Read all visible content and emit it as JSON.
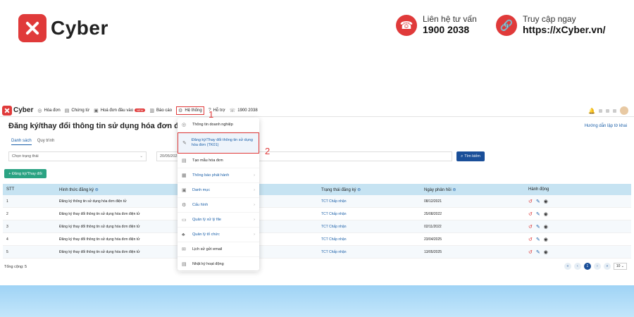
{
  "banner": {
    "logo_text": "Cyber",
    "contact1": {
      "line1": "Liên hệ tư vấn",
      "line2": "1900 2038",
      "icon": "phone-icon"
    },
    "contact2": {
      "line1": "Truy cập ngay",
      "line2": "https://xCyber.vn/",
      "icon": "link-icon"
    }
  },
  "navbar": {
    "logo": "Cyber",
    "items": [
      {
        "label": "Hóa đơn",
        "icon": "invoice-icon"
      },
      {
        "label": "Chứng từ",
        "icon": "document-icon"
      },
      {
        "label": "Hoá đơn đầu vào",
        "icon": "inbox-icon",
        "badge": "NEW"
      },
      {
        "label": "Báo cáo",
        "icon": "report-icon"
      },
      {
        "label": "Hệ thống",
        "icon": "settings-icon"
      },
      {
        "label": "Hỗ trợ",
        "icon": "help-icon"
      },
      {
        "label": "1900 2038",
        "icon": "phone-icon"
      }
    ]
  },
  "page": {
    "title": "Đăng ký/thay đổi thông tin sử dụng hóa đơn điện tử",
    "help_link": "Hướng dẫn lập tờ khai",
    "tabs": [
      "Danh sách",
      "Quy trình"
    ],
    "filter_placeholder": "Chọn trạng thái",
    "date_value": "20/05/2025",
    "search_label": "Tìm kiếm",
    "add_label": "+ Đăng ký/Thay đổi",
    "total_label": "Tổng cộng: 5"
  },
  "table": {
    "headers": [
      "STT",
      "Hình thức đăng ký",
      "Trạng thái đăng ký",
      "Ngày phản hồi",
      "Hành động"
    ],
    "rows": [
      {
        "stt": "1",
        "form": "Đăng ký thông tin sử dụng hóa đơn điện tử",
        "status": "TCT Chấp nhận",
        "date": "08/12/2021"
      },
      {
        "stt": "2",
        "form": "Đăng ký thay đổi thông tin sử dụng hóa đơn điện tử",
        "status": "TCT Chấp nhận",
        "date": "25/08/2022"
      },
      {
        "stt": "3",
        "form": "Đăng ký thay đổi thông tin sử dụng hóa đơn điện tử",
        "status": "TCT Chấp nhận",
        "date": "02/11/2022"
      },
      {
        "stt": "4",
        "form": "Đăng ký thay đổi thông tin sử dụng hóa đơn điện tử",
        "status": "TCT Chấp nhận",
        "date": "23/04/2025"
      },
      {
        "stt": "5",
        "form": "Đăng ký thay đổi thông tin sử dụng hóa đơn điện tử",
        "status": "TCT Chấp nhận",
        "date": "13/05/2025"
      }
    ]
  },
  "pager": {
    "current": "1",
    "page_size": "10"
  },
  "menu": {
    "items": [
      {
        "label": "Thông tin doanh nghiệp",
        "icon": "company-icon"
      },
      {
        "label": "Đăng ký/Thay đổi thông tin sử dụng hóa đơn (TK01)",
        "icon": "edit-icon"
      },
      {
        "label": "Tạo mẫu hóa đơn",
        "icon": "template-icon"
      },
      {
        "label": "Thông báo phát hành",
        "icon": "announce-icon"
      },
      {
        "label": "Danh mục",
        "icon": "list-icon"
      },
      {
        "label": "Cấu hình",
        "icon": "gear-icon"
      },
      {
        "label": "Quản lý xử lý file",
        "icon": "file-icon"
      },
      {
        "label": "Quản lý tổ chức",
        "icon": "org-icon"
      },
      {
        "label": "Lịch sử gửi email",
        "icon": "mail-icon"
      },
      {
        "label": "Nhật ký hoạt động",
        "icon": "log-icon"
      }
    ]
  },
  "annotations": {
    "step1": "1",
    "step2": "2"
  }
}
